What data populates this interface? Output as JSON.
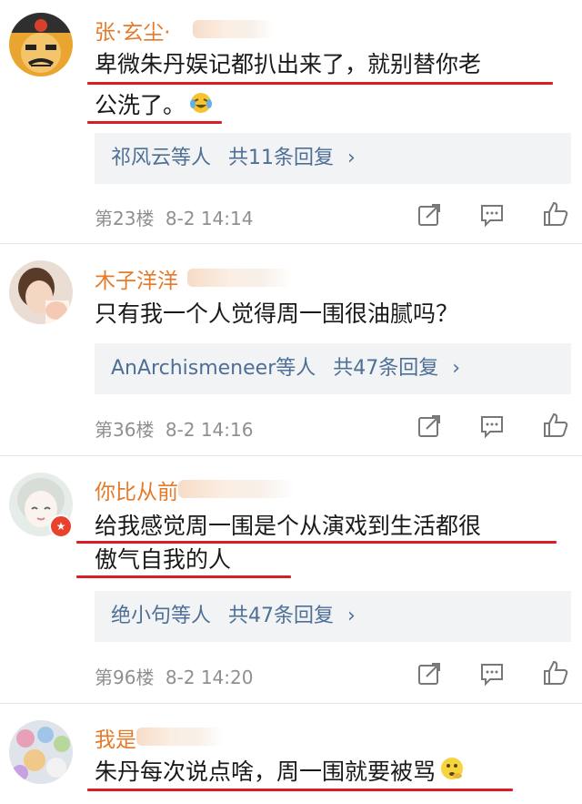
{
  "comments": [
    {
      "username": "张·玄尘·",
      "text_lines": [
        "卑微朱丹娱记都扒出来了，就别替你老",
        "公洗了。"
      ],
      "replies": {
        "names": "祁风云",
        "suffix": "等人",
        "count": "共11条回复",
        "chevron": "›"
      },
      "floor": "第23楼",
      "time": "8-2 14:14",
      "emoji": "laugh-cry-emoji"
    },
    {
      "username": "木子洋洋",
      "text_lines": [
        "只有我一个人觉得周一围很油腻吗？"
      ],
      "replies": {
        "names": "AnArchismeneer",
        "suffix": "等人",
        "count": "共47条回复",
        "chevron": "›"
      },
      "floor": "第36楼",
      "time": "8-2 14:16"
    },
    {
      "username": "你比从前",
      "badge": "★",
      "text_lines": [
        "给我感觉周一围是个从演戏到生活都很",
        "傲气自我的人"
      ],
      "replies": {
        "names": "绝小句",
        "suffix": "等人",
        "count": "共47条回复",
        "chevron": "›"
      },
      "floor": "第96楼",
      "time": "8-2 14:20"
    },
    {
      "username": "我是",
      "text_lines": [
        "朱丹每次说点啥，周一围就要被骂"
      ],
      "emoji": "thinking-emoji"
    }
  ],
  "icons": {
    "share": "share-icon",
    "comment": "comment-icon",
    "like": "like-icon"
  },
  "colors": {
    "username": "#e57a2a",
    "link": "#4e6f96",
    "underline": "#d81e24",
    "meta": "#8f8f8f"
  }
}
